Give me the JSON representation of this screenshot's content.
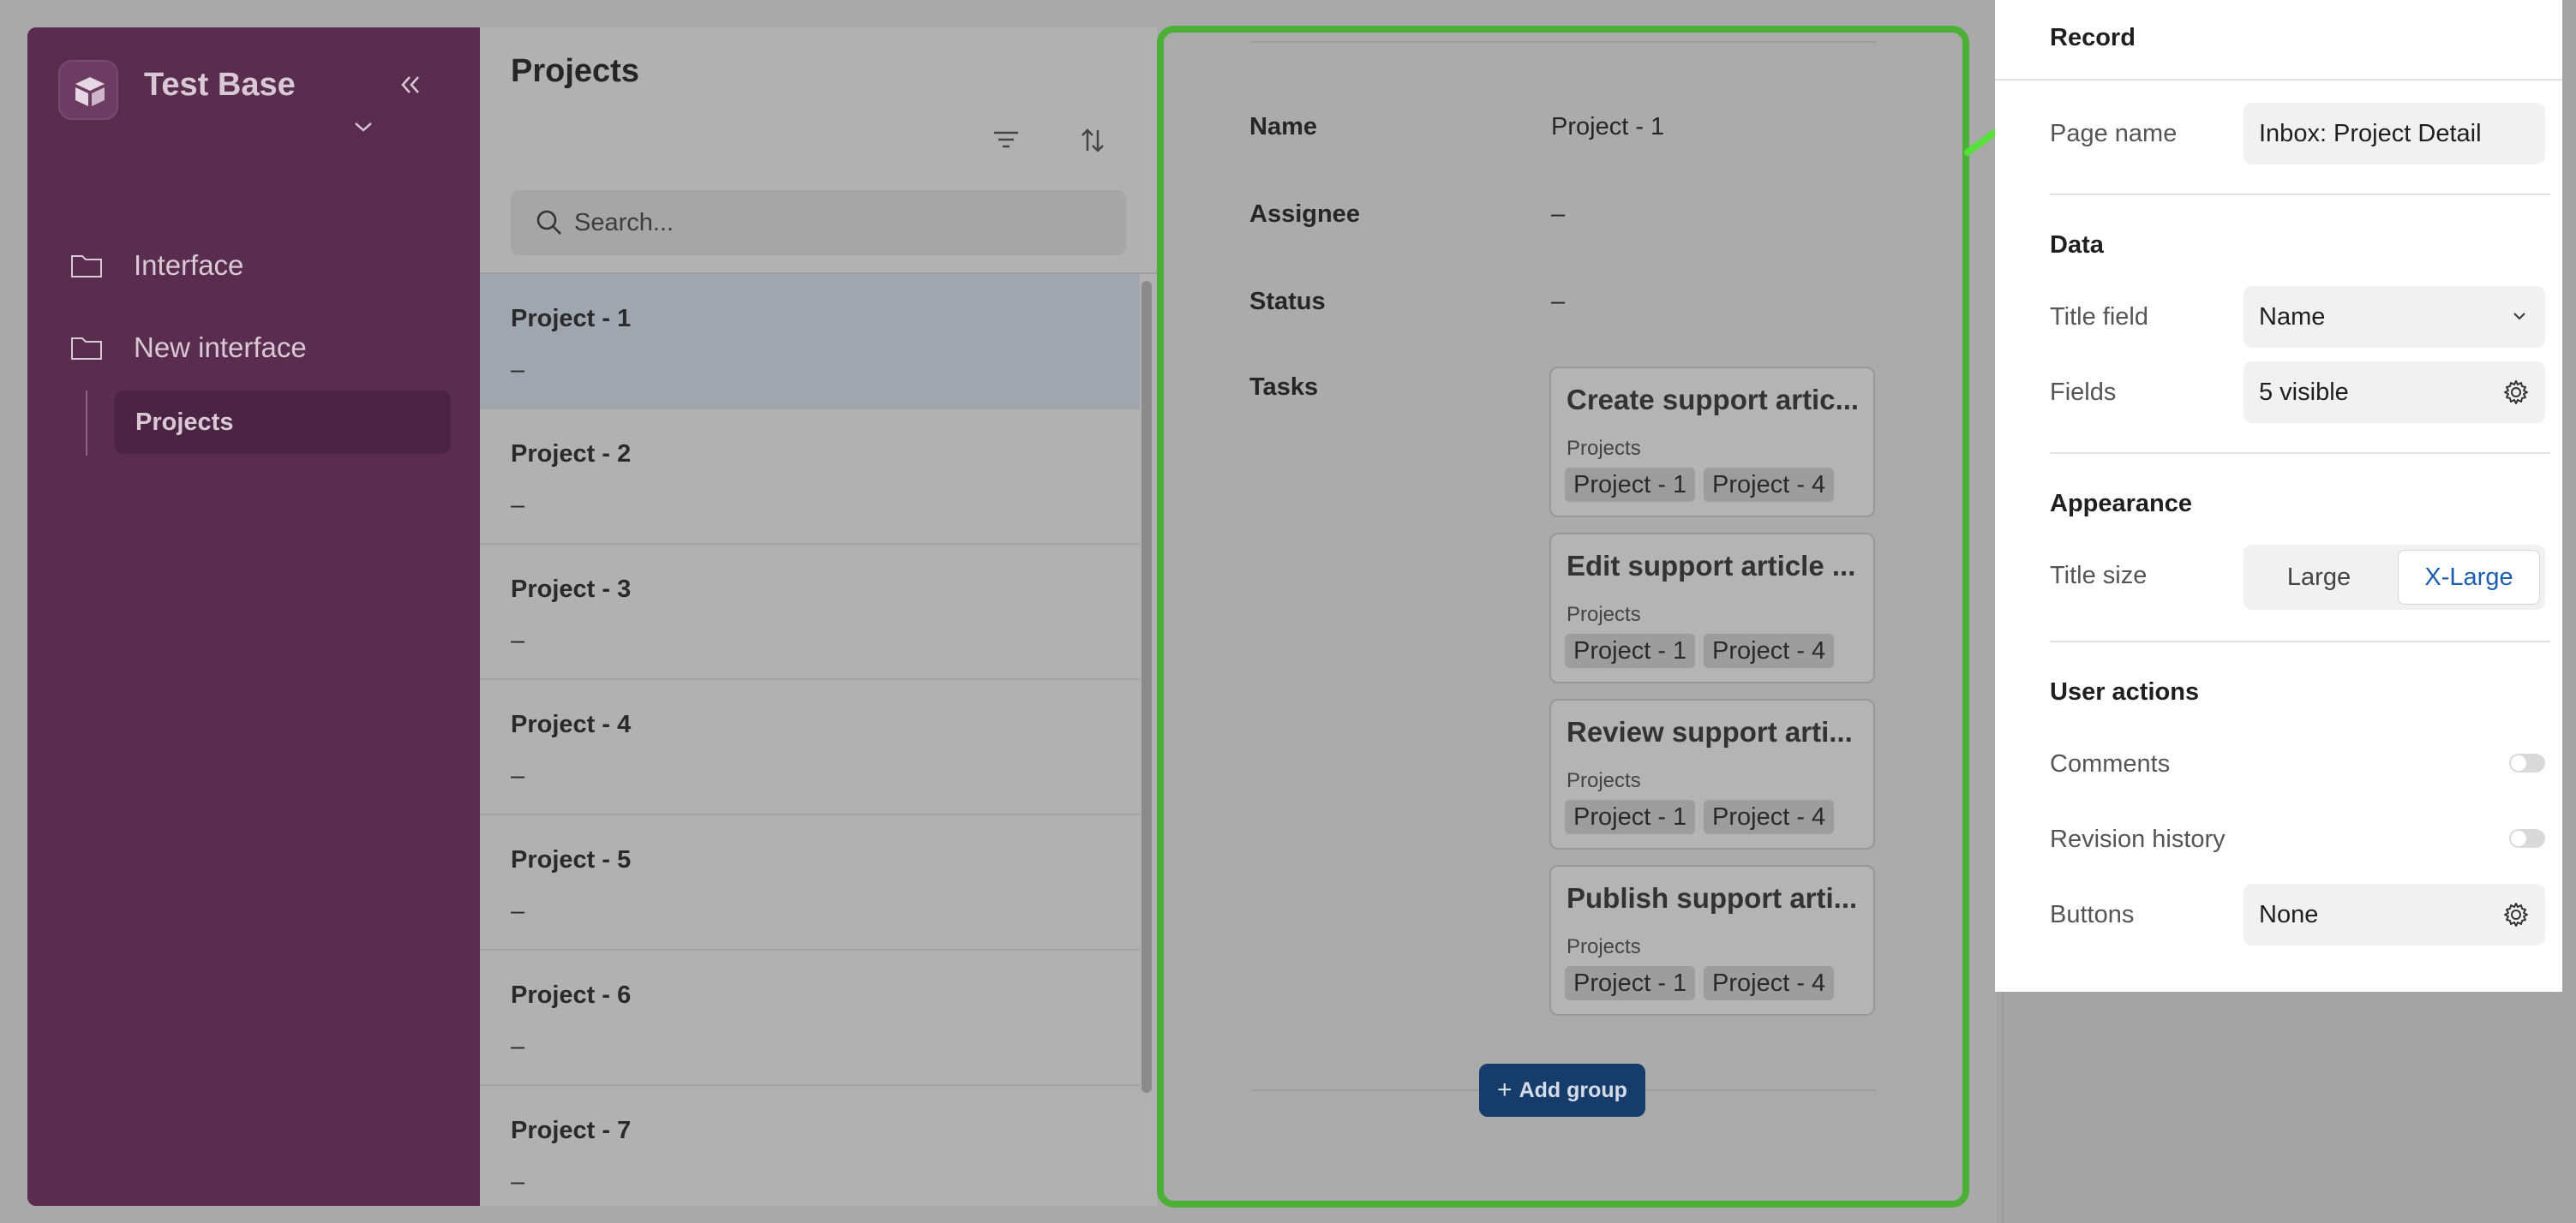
{
  "sidebar": {
    "base_name": "Test Base",
    "items": [
      {
        "label": "Interface"
      },
      {
        "label": "New interface"
      },
      {
        "label": "Projects"
      }
    ]
  },
  "list": {
    "title": "Projects",
    "search_placeholder": "Search...",
    "rows": [
      {
        "name": "Project - 1",
        "sub": "–"
      },
      {
        "name": "Project - 2",
        "sub": "–"
      },
      {
        "name": "Project - 3",
        "sub": "–"
      },
      {
        "name": "Project - 4",
        "sub": "–"
      },
      {
        "name": "Project - 5",
        "sub": "–"
      },
      {
        "name": "Project - 6",
        "sub": "–"
      },
      {
        "name": "Project - 7",
        "sub": "–"
      }
    ]
  },
  "detail": {
    "fields": {
      "name_label": "Name",
      "name_value": "Project - 1",
      "assignee_label": "Assignee",
      "assignee_value": "–",
      "status_label": "Status",
      "status_value": "–",
      "tasks_label": "Tasks"
    },
    "tasks": [
      {
        "title": "Create support artic...",
        "projects_label": "Projects",
        "chips": [
          "Project - 1",
          "Project - 4"
        ]
      },
      {
        "title": "Edit support article ...",
        "projects_label": "Projects",
        "chips": [
          "Project - 1",
          "Project - 4"
        ]
      },
      {
        "title": "Review support arti...",
        "projects_label": "Projects",
        "chips": [
          "Project - 1",
          "Project - 4"
        ]
      },
      {
        "title": "Publish support arti...",
        "projects_label": "Projects",
        "chips": [
          "Project - 1",
          "Project - 4"
        ]
      }
    ],
    "add_group_label": "Add group"
  },
  "record_panel": {
    "title": "Record",
    "page_name_label": "Page name",
    "page_name_value": "Inbox: Project Detail",
    "data_section": "Data",
    "title_field_label": "Title field",
    "title_field_value": "Name",
    "fields_label": "Fields",
    "fields_value": "5 visible",
    "appearance_section": "Appearance",
    "title_size_label": "Title size",
    "title_size_options": [
      "Large",
      "X-Large"
    ],
    "title_size_selected": "X-Large",
    "user_actions_section": "User actions",
    "comments_label": "Comments",
    "comments_enabled": false,
    "revision_label": "Revision history",
    "revision_enabled": false,
    "buttons_label": "Buttons",
    "buttons_value": "None"
  },
  "colors": {
    "sidebar_bg": "#5a2d4f",
    "highlight_border": "#4caf37",
    "primary_button": "#163c6b",
    "selected_segment": "#1d5fae"
  },
  "icons": [
    "base-logo-icon",
    "chevron-down-icon",
    "collapse-double-chevron-icon",
    "folder-icon",
    "filter-icon",
    "sort-icon",
    "search-icon",
    "plus-icon",
    "gear-icon",
    "arrow-icon"
  ]
}
